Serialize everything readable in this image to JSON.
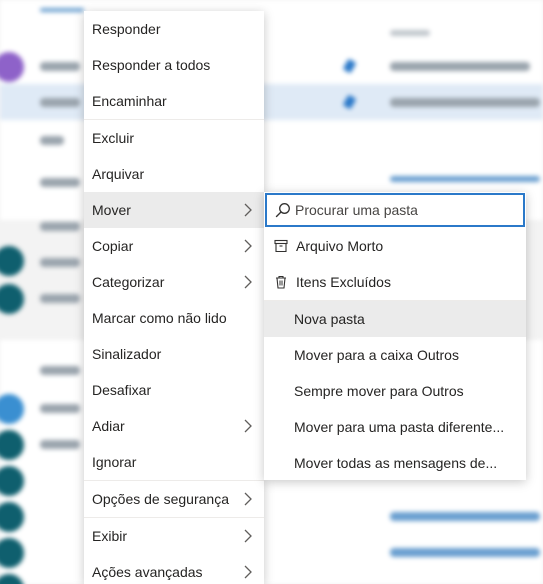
{
  "context_menu": {
    "items": [
      {
        "label": "Responder"
      },
      {
        "label": "Responder a todos"
      },
      {
        "label": "Encaminhar"
      },
      {
        "label": "Excluir"
      },
      {
        "label": "Arquivar"
      },
      {
        "label": "Mover"
      },
      {
        "label": "Copiar"
      },
      {
        "label": "Categorizar"
      },
      {
        "label": "Marcar como não lido"
      },
      {
        "label": "Sinalizador"
      },
      {
        "label": "Desafixar"
      },
      {
        "label": "Adiar"
      },
      {
        "label": "Ignorar"
      },
      {
        "label": "Opções de segurança"
      },
      {
        "label": "Exibir"
      },
      {
        "label": "Ações avançadas"
      }
    ]
  },
  "move_submenu": {
    "search_placeholder": "Procurar uma pasta",
    "folders": [
      {
        "label": "Arquivo Morto",
        "icon": "archive-icon"
      },
      {
        "label": "Itens Excluídos",
        "icon": "trash-icon"
      }
    ],
    "actions": [
      {
        "label": "Nova pasta"
      },
      {
        "label": "Mover para a caixa Outros"
      },
      {
        "label": "Sempre mover para Outros"
      },
      {
        "label": "Mover para uma pasta diferente..."
      },
      {
        "label": "Mover todas as mensagens de..."
      }
    ]
  },
  "colors": {
    "accent": "#2b79c9",
    "menu_bg": "#ffffff",
    "hover_bg": "#ebebeb",
    "text": "#252423"
  }
}
